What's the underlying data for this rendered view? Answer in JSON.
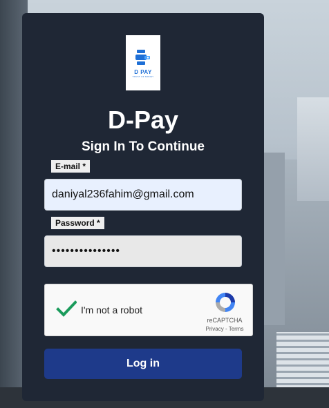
{
  "app": {
    "logo": {
      "text": "D PAY",
      "tagline": "TRUST OF MONEY"
    },
    "title": "D-Pay",
    "subtitle": "Sign In To Continue"
  },
  "form": {
    "email": {
      "label": "E-mail *",
      "value": "daniyal236fahim@gmail.com"
    },
    "password": {
      "label": "Password *",
      "masked_value": "•••••••••••••••"
    },
    "captcha": {
      "text": "I'm not a robot",
      "brand": "reCAPTCHA",
      "links": "Privacy - Terms",
      "checked": true,
      "check_color": "#1a9b5b"
    },
    "login_label": "Log in"
  },
  "colors": {
    "card": "#1f2735",
    "button": "#1e3a8a",
    "email_autofill": "#e8f0fe",
    "brand_blue": "#1e6fd6"
  },
  "icons": [
    "dpay-logo-icon",
    "checkmark-icon",
    "recaptcha-icon"
  ]
}
